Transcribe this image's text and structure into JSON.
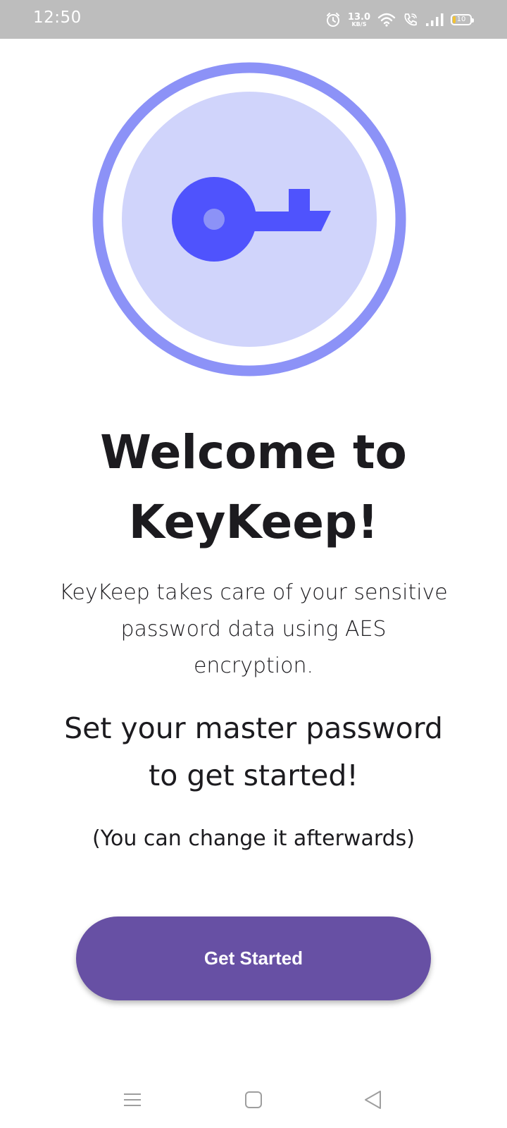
{
  "status_bar": {
    "time": "12:50",
    "net_speed_value": "13.0",
    "net_speed_unit": "KB/S",
    "battery_level": "10",
    "icons": [
      "alarm-icon",
      "wifi-icon",
      "wifi-calling-icon",
      "cellular-signal-icon",
      "battery-icon"
    ]
  },
  "hero": {
    "icon": "key-icon",
    "colors": {
      "outer_ring": "#8c92f7",
      "inner_disc": "#d0d4fb",
      "key": "#4f53fd",
      "key_hole": "#8c92f7"
    }
  },
  "welcome": {
    "title_line1": "Welcome to",
    "title_line2": "KeyKeep!",
    "description_line1": "KeyKeep takes care of your sensitive",
    "description_line2": "password data using AES",
    "description_line3": "encryption.",
    "cta_line1": "Set your master password",
    "cta_line2": "to get started!",
    "note": "(You can change it afterwards)"
  },
  "actions": {
    "get_started_label": "Get Started",
    "button_color": "#6750a4"
  },
  "nav_bar": {
    "icons": [
      "menu-icon",
      "home-icon",
      "back-icon"
    ]
  }
}
